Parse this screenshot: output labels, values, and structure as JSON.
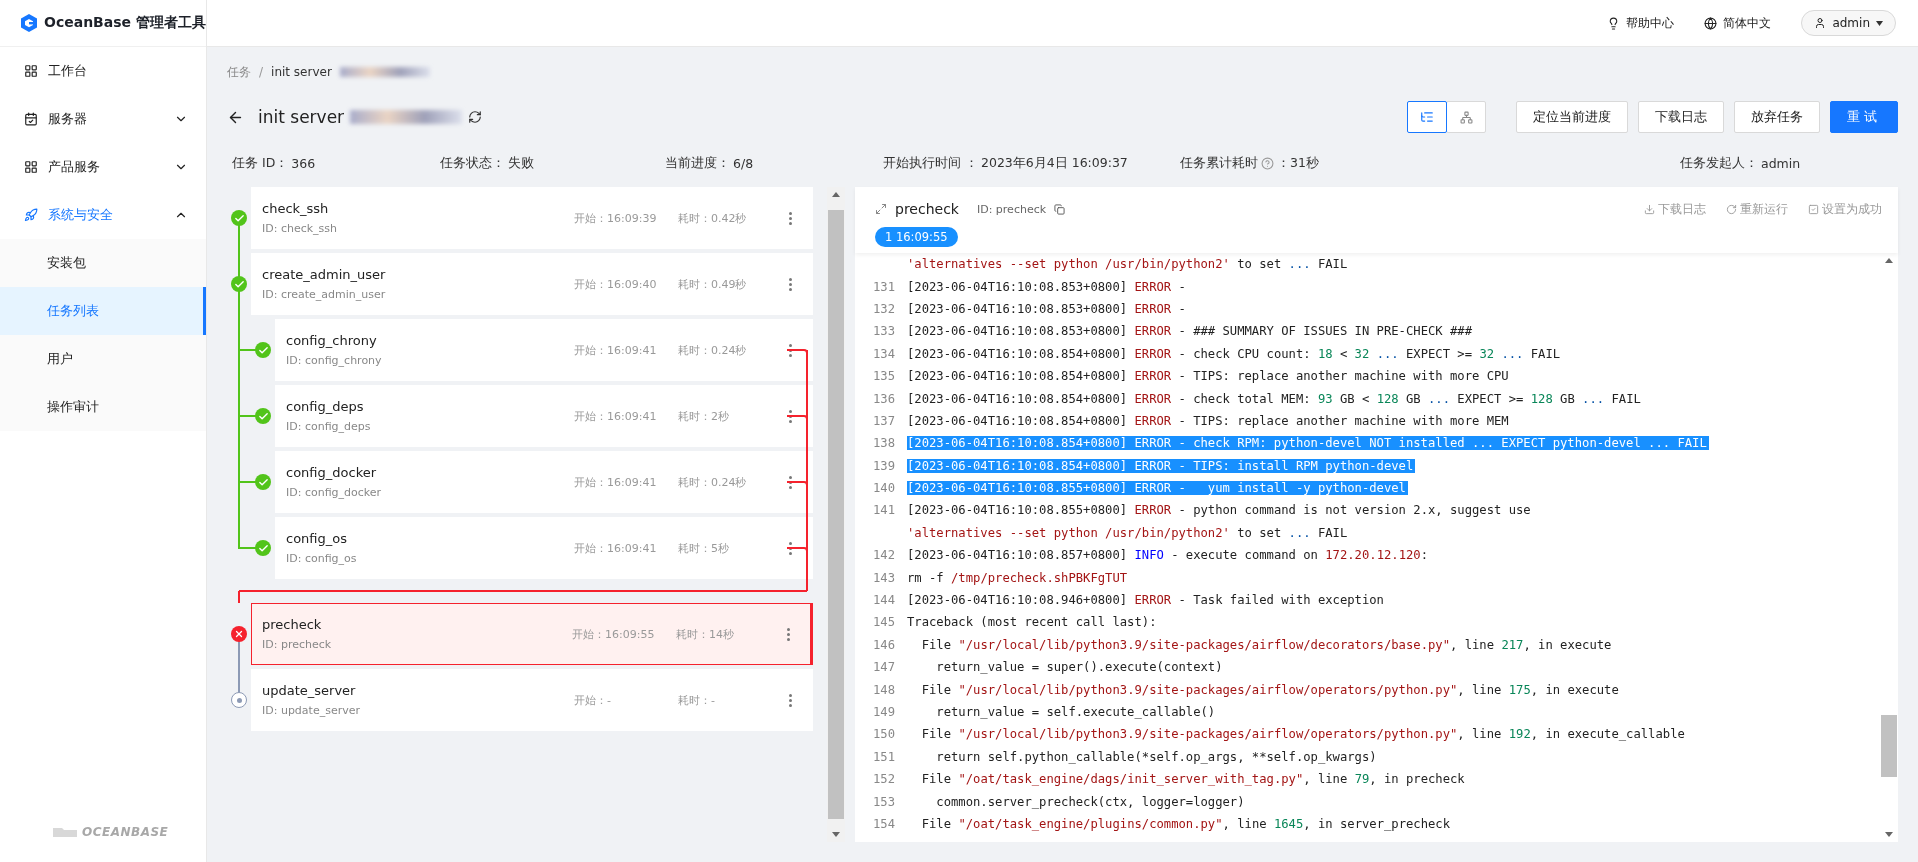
{
  "app": {
    "logo_text": "OceanBase 管理者工具",
    "footer_logo": "OCEANBASE"
  },
  "sidebar": {
    "items": [
      {
        "label": "工作台",
        "selected": false
      },
      {
        "label": "服务器",
        "selected": false,
        "expanded": false
      },
      {
        "label": "产品服务",
        "selected": false,
        "expanded": false
      },
      {
        "label": "系统与安全",
        "selected": true,
        "expanded": true,
        "children": [
          {
            "label": "安装包",
            "selected": false
          },
          {
            "label": "任务列表",
            "selected": true
          },
          {
            "label": "用户",
            "selected": false
          },
          {
            "label": "操作审计",
            "selected": false
          }
        ]
      }
    ]
  },
  "topbar": {
    "help": "帮助中心",
    "language": "简体中文",
    "user": "admin"
  },
  "breadcrumb": [
    {
      "label": "任务"
    },
    {
      "label": "init server",
      "redacted": true
    }
  ],
  "breadcrumb_separator": "/",
  "title": {
    "text": "init server",
    "redacted": true
  },
  "view_toggle": [
    {
      "kind": "list",
      "selected": true
    },
    {
      "kind": "graph",
      "selected": false
    }
  ],
  "actions": [
    {
      "label": "定位当前进度",
      "primary": false
    },
    {
      "label": "下载日志",
      "primary": false
    },
    {
      "label": "放弃任务",
      "primary": false
    },
    {
      "label": "重试",
      "primary": true
    }
  ],
  "info": [
    {
      "label": "任务 ID：",
      "value": "366"
    },
    {
      "label": "任务状态：",
      "value": "失败"
    },
    {
      "label": "当前进度：",
      "value": "6/8"
    },
    {
      "label": "开始执行时间 ：",
      "value": "2023年6月4日 16:09:37"
    },
    {
      "label": "任务累计耗时",
      "value": "：31秒",
      "help": true
    },
    {
      "label": "任务发起人：",
      "value": "admin"
    }
  ],
  "tasks": [
    {
      "name": "check_ssh",
      "id": "ID: check_ssh",
      "start": "开始：16:09:39",
      "duration": "耗时：0.42秒",
      "kind": "success",
      "selected": false
    },
    {
      "name": "create_admin_user",
      "id": "ID: create_admin_user",
      "start": "开始：16:09:40",
      "duration": "耗时：0.49秒",
      "kind": "success",
      "selected": false,
      "children": [
        {
          "name": "config_chrony",
          "id": "ID: config_chrony",
          "start": "开始：16:09:41",
          "duration": "耗时：0.24秒",
          "kind": "success",
          "selected": false
        },
        {
          "name": "config_deps",
          "id": "ID: config_deps",
          "start": "开始：16:09:41",
          "duration": "耗时：2秒",
          "kind": "success",
          "selected": false
        },
        {
          "name": "config_docker",
          "id": "ID: config_docker",
          "start": "开始：16:09:41",
          "duration": "耗时：0.24秒",
          "kind": "success",
          "selected": false
        },
        {
          "name": "config_os",
          "id": "ID: config_os",
          "start": "开始：16:09:41",
          "duration": "耗时：5秒",
          "kind": "success",
          "selected": false
        }
      ]
    },
    {
      "name": "precheck",
      "id": "ID: precheck",
      "start": "开始：16:09:55",
      "duration": "耗时：14秒",
      "kind": "failed",
      "selected": true
    },
    {
      "name": "update_server",
      "id": "ID: update_server",
      "start": "开始：-",
      "duration": "耗时：-",
      "kind": "pending",
      "selected": false
    }
  ],
  "log": {
    "title": "precheck",
    "id": "ID: precheck",
    "actions": [
      "下载日志",
      "重新运行",
      "设置为成功"
    ],
    "tag": "1 16:09:55",
    "lines": [
      {
        "selected": false,
        "segments": [
          {
            "kind": "string",
            "text": "'alternatives --set python /usr/bin/python2'"
          },
          {
            "kind": "text",
            "text": " to set "
          },
          {
            "kind": "dots",
            "text": "..."
          },
          {
            "kind": "text",
            "text": " FAIL"
          }
        ]
      },
      {
        "number": "131",
        "selected": false,
        "segments": [
          {
            "kind": "text",
            "text": "[2023-06-04T16:10:08.853+0800] "
          },
          {
            "kind": "error",
            "text": "ERROR"
          },
          {
            "kind": "text",
            "text": " -"
          }
        ]
      },
      {
        "number": "132",
        "selected": false,
        "segments": [
          {
            "kind": "text",
            "text": "[2023-06-04T16:10:08.853+0800] "
          },
          {
            "kind": "error",
            "text": "ERROR"
          },
          {
            "kind": "text",
            "text": " -"
          }
        ]
      },
      {
        "number": "133",
        "selected": false,
        "segments": [
          {
            "kind": "text",
            "text": "[2023-06-04T16:10:08.853+0800] "
          },
          {
            "kind": "error",
            "text": "ERROR"
          },
          {
            "kind": "text",
            "text": " - ### SUMMARY OF ISSUES IN PRE-CHECK ###"
          }
        ]
      },
      {
        "number": "134",
        "selected": false,
        "segments": [
          {
            "kind": "text",
            "text": "[2023-06-04T16:10:08.854+0800] "
          },
          {
            "kind": "error",
            "text": "ERROR"
          },
          {
            "kind": "text",
            "text": " - check CPU count: "
          },
          {
            "kind": "number",
            "text": "18"
          },
          {
            "kind": "text",
            "text": " < "
          },
          {
            "kind": "number",
            "text": "32"
          },
          {
            "kind": "dots",
            "text": " ..."
          },
          {
            "kind": "text",
            "text": " EXPECT >= "
          },
          {
            "kind": "number",
            "text": "32"
          },
          {
            "kind": "dots",
            "text": " ..."
          },
          {
            "kind": "text",
            "text": " FAIL"
          }
        ]
      },
      {
        "number": "135",
        "selected": false,
        "segments": [
          {
            "kind": "text",
            "text": "[2023-06-04T16:10:08.854+0800] "
          },
          {
            "kind": "error",
            "text": "ERROR"
          },
          {
            "kind": "text",
            "text": " - TIPS: replace another machine with more CPU"
          }
        ]
      },
      {
        "number": "136",
        "selected": false,
        "segments": [
          {
            "kind": "text",
            "text": "[2023-06-04T16:10:08.854+0800] "
          },
          {
            "kind": "error",
            "text": "ERROR"
          },
          {
            "kind": "text",
            "text": " - check total MEM: "
          },
          {
            "kind": "number",
            "text": "93"
          },
          {
            "kind": "text",
            "text": " GB < "
          },
          {
            "kind": "number",
            "text": "128"
          },
          {
            "kind": "text",
            "text": " GB "
          },
          {
            "kind": "dots",
            "text": "..."
          },
          {
            "kind": "text",
            "text": " EXPECT >= "
          },
          {
            "kind": "number",
            "text": "128"
          },
          {
            "kind": "text",
            "text": " GB "
          },
          {
            "kind": "dots",
            "text": "..."
          },
          {
            "kind": "text",
            "text": " FAIL"
          }
        ]
      },
      {
        "number": "137",
        "selected": false,
        "segments": [
          {
            "kind": "text",
            "text": "[2023-06-04T16:10:08.854+0800] "
          },
          {
            "kind": "error",
            "text": "ERROR"
          },
          {
            "kind": "text",
            "text": " - TIPS: replace another machine with more MEM"
          }
        ]
      },
      {
        "number": "138",
        "selected": true,
        "segments": [
          {
            "kind": "text",
            "text": "[2023-06-04T16:10:08.854+0800] ERROR - check RPM: python-devel NOT installed ... EXPECT python-devel ... FAIL"
          }
        ]
      },
      {
        "number": "139",
        "selected": true,
        "segments": [
          {
            "kind": "text",
            "text": "[2023-06-04T16:10:08.854+0800] ERROR - TIPS: install RPM python-devel"
          }
        ]
      },
      {
        "number": "140",
        "selected": true,
        "segments": [
          {
            "kind": "text",
            "text": "[2023-06-04T16:10:08.855+0800] ERROR -   yum install -y python-devel"
          }
        ]
      },
      {
        "number": "141",
        "selected": false,
        "segments": [
          {
            "kind": "text",
            "text": "[2023-06-04T16:10:08.855+0800] "
          },
          {
            "kind": "error",
            "text": "ERROR"
          },
          {
            "kind": "text",
            "text": " - python command is not version 2.x, suggest use"
          }
        ]
      },
      {
        "selected": false,
        "segments": [
          {
            "kind": "string",
            "text": "'alternatives --set python /usr/bin/python2'"
          },
          {
            "kind": "text",
            "text": " to set "
          },
          {
            "kind": "dots",
            "text": "..."
          },
          {
            "kind": "text",
            "text": " FAIL"
          }
        ]
      },
      {
        "number": "142",
        "selected": false,
        "segments": [
          {
            "kind": "text",
            "text": "[2023-06-04T16:10:08.857+0800] "
          },
          {
            "kind": "info",
            "text": "INFO"
          },
          {
            "kind": "text",
            "text": " - execute command on "
          },
          {
            "kind": "string",
            "text": "172.20.12.120"
          },
          {
            "kind": "text",
            "text": ":"
          }
        ]
      },
      {
        "number": "143",
        "selected": false,
        "segments": [
          {
            "kind": "text",
            "text": "rm -f "
          },
          {
            "kind": "string",
            "text": "/tmp/precheck.shPBKFgTUT"
          }
        ]
      },
      {
        "number": "144",
        "selected": false,
        "segments": [
          {
            "kind": "text",
            "text": "[2023-06-04T16:10:08.946+0800] "
          },
          {
            "kind": "error",
            "text": "ERROR"
          },
          {
            "kind": "text",
            "text": " - Task failed with exception"
          }
        ]
      },
      {
        "number": "145",
        "selected": false,
        "segments": [
          {
            "kind": "text",
            "text": "Traceback (most recent call last):"
          }
        ]
      },
      {
        "number": "146",
        "selected": false,
        "segments": [
          {
            "kind": "text",
            "text": "  File "
          },
          {
            "kind": "string",
            "text": "\"/usr/local/lib/python3.9/site-packages/airflow/decorators/base.py\""
          },
          {
            "kind": "text",
            "text": ", line "
          },
          {
            "kind": "number",
            "text": "217"
          },
          {
            "kind": "text",
            "text": ", in execute"
          }
        ]
      },
      {
        "number": "147",
        "selected": false,
        "segments": [
          {
            "kind": "text",
            "text": "    return_value = super().execute(context)"
          }
        ]
      },
      {
        "number": "148",
        "selected": false,
        "segments": [
          {
            "kind": "text",
            "text": "  File "
          },
          {
            "kind": "string",
            "text": "\"/usr/local/lib/python3.9/site-packages/airflow/operators/python.py\""
          },
          {
            "kind": "text",
            "text": ", line "
          },
          {
            "kind": "number",
            "text": "175"
          },
          {
            "kind": "text",
            "text": ", in execute"
          }
        ]
      },
      {
        "number": "149",
        "selected": false,
        "segments": [
          {
            "kind": "text",
            "text": "    return_value = self.execute_callable()"
          }
        ]
      },
      {
        "number": "150",
        "selected": false,
        "segments": [
          {
            "kind": "text",
            "text": "  File "
          },
          {
            "kind": "string",
            "text": "\"/usr/local/lib/python3.9/site-packages/airflow/operators/python.py\""
          },
          {
            "kind": "text",
            "text": ", line "
          },
          {
            "kind": "number",
            "text": "192"
          },
          {
            "kind": "text",
            "text": ", in execute_callable"
          }
        ]
      },
      {
        "number": "151",
        "selected": false,
        "segments": [
          {
            "kind": "text",
            "text": "    return self.python_callable(*self.op_args, **self.op_kwargs)"
          }
        ]
      },
      {
        "number": "152",
        "selected": false,
        "segments": [
          {
            "kind": "text",
            "text": "  File "
          },
          {
            "kind": "string",
            "text": "\"/oat/task_engine/dags/init_server_with_tag.py\""
          },
          {
            "kind": "text",
            "text": ", line "
          },
          {
            "kind": "number",
            "text": "79"
          },
          {
            "kind": "text",
            "text": ", in precheck"
          }
        ]
      },
      {
        "number": "153",
        "selected": false,
        "segments": [
          {
            "kind": "text",
            "text": "    common.server_precheck(ctx, logger=logger)"
          }
        ]
      },
      {
        "number": "154",
        "selected": false,
        "segments": [
          {
            "kind": "text",
            "text": "  File "
          },
          {
            "kind": "string",
            "text": "\"/oat/task_engine/plugins/common.py\""
          },
          {
            "kind": "text",
            "text": ", line "
          },
          {
            "kind": "number",
            "text": "1645"
          },
          {
            "kind": "text",
            "text": ", in server_precheck"
          }
        ]
      }
    ]
  }
}
